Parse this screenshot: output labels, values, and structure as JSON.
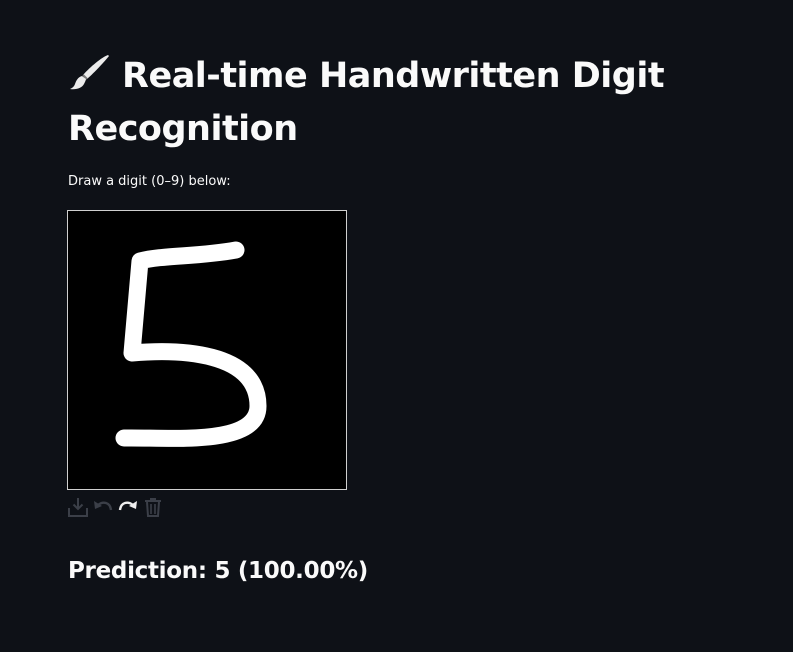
{
  "header": {
    "title": "Real-time Handwritten Digit Recognition",
    "icon": "paintbrush-icon"
  },
  "instruction": "Draw a digit (0–9) below:",
  "canvas": {
    "background": "#000000",
    "stroke_color": "#ffffff",
    "drawn_digit": "5"
  },
  "toolbar": {
    "icons": [
      "download-icon",
      "undo-icon",
      "redo-icon",
      "trash-icon"
    ]
  },
  "result": {
    "prediction": "Prediction: 5 (100.00%)"
  },
  "colors": {
    "background": "#0e1117",
    "text": "#fafafa"
  }
}
